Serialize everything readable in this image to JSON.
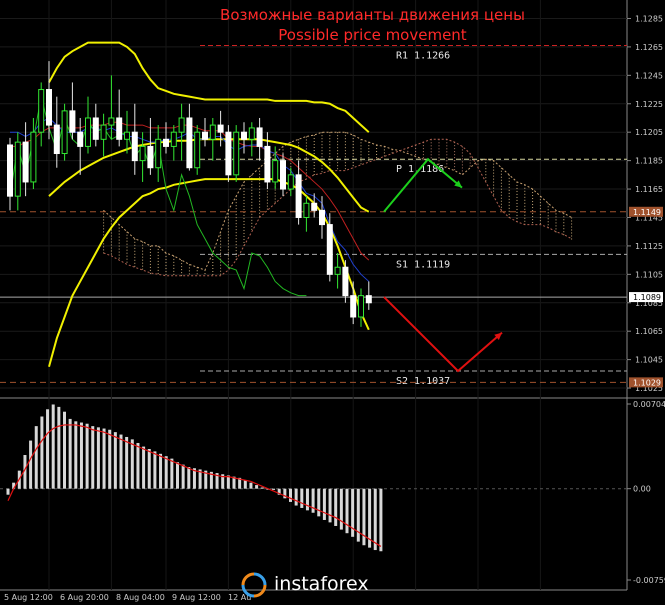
{
  "chart_data": [
    {
      "type": "candlestick",
      "title": "Возможные варианты движения цены",
      "subtitle": "Possible price movement",
      "y_ticks": [
        "1.1285",
        "1.1265",
        "1.1245",
        "1.1225",
        "1.1205",
        "1.1185",
        "1.1165",
        "1.1145",
        "1.1125",
        "1.1105",
        "1.1085",
        "1.1065",
        "1.1045",
        "1.1025"
      ],
      "x_ticks": [
        "5 Aug 12:00",
        "6 Aug 20:00",
        "8 Aug 04:00",
        "9 Aug 12:00",
        "12 Au"
      ],
      "ylim": [
        1.1018,
        1.1298
      ],
      "levels": [
        {
          "name": "R1",
          "label": "R1  1.1266",
          "value": 1.1266,
          "color": "#cc2222"
        },
        {
          "name": "P",
          "label": "P  1.1186",
          "value": 1.1186,
          "color": "#d8d8a0"
        },
        {
          "name": "S1",
          "label": "S1  1.1119",
          "value": 1.1119,
          "color": "#aaaaaa"
        },
        {
          "name": "S2",
          "label": "S2  1.1037",
          "value": 1.1037,
          "color": "#aaaaaa"
        }
      ],
      "price_markers": [
        {
          "label": "1.1149",
          "value": 1.1149,
          "color": "#a0522d"
        },
        {
          "label": "1.1089",
          "value": 1.1089,
          "color": "#ffffff"
        },
        {
          "label": "1.1029",
          "value": 1.1029,
          "color": "#a0522d"
        }
      ],
      "candles": [
        [
          1.1196,
          1.1201,
          1.115,
          1.116
        ],
        [
          1.116,
          1.1205,
          1.115,
          1.1198
        ],
        [
          1.1198,
          1.1212,
          1.116,
          1.117
        ],
        [
          1.117,
          1.1215,
          1.1165,
          1.1205
        ],
        [
          1.1205,
          1.124,
          1.1195,
          1.1235
        ],
        [
          1.1235,
          1.1255,
          1.12,
          1.121
        ],
        [
          1.121,
          1.123,
          1.118,
          1.119
        ],
        [
          1.119,
          1.1225,
          1.1185,
          1.122
        ],
        [
          1.122,
          1.124,
          1.12,
          1.1205
        ],
        [
          1.1205,
          1.1215,
          1.1175,
          1.1195
        ],
        [
          1.1195,
          1.123,
          1.119,
          1.1215
        ],
        [
          1.1215,
          1.1225,
          1.1195,
          1.12
        ],
        [
          1.12,
          1.1218,
          1.1188,
          1.121
        ],
        [
          1.121,
          1.1245,
          1.12,
          1.1215
        ],
        [
          1.1215,
          1.1235,
          1.1195,
          1.12
        ],
        [
          1.12,
          1.122,
          1.119,
          1.1205
        ],
        [
          1.1205,
          1.1225,
          1.1175,
          1.1185
        ],
        [
          1.1185,
          1.1205,
          1.117,
          1.1195
        ],
        [
          1.1195,
          1.1215,
          1.1175,
          1.118
        ],
        [
          1.118,
          1.121,
          1.117,
          1.12
        ],
        [
          1.12,
          1.1212,
          1.119,
          1.1195
        ],
        [
          1.1195,
          1.121,
          1.1185,
          1.1205
        ],
        [
          1.1205,
          1.1225,
          1.1185,
          1.1215
        ],
        [
          1.1215,
          1.1225,
          1.1178,
          1.118
        ],
        [
          1.118,
          1.121,
          1.1175,
          1.1205
        ],
        [
          1.1205,
          1.1215,
          1.1195,
          1.12
        ],
        [
          1.12,
          1.1215,
          1.1185,
          1.121
        ],
        [
          1.121,
          1.122,
          1.1195,
          1.1205
        ],
        [
          1.1205,
          1.121,
          1.117,
          1.1175
        ],
        [
          1.1175,
          1.121,
          1.117,
          1.1205
        ],
        [
          1.1205,
          1.1212,
          1.119,
          1.12
        ],
        [
          1.12,
          1.1212,
          1.1188,
          1.1208
        ],
        [
          1.1208,
          1.1215,
          1.1185,
          1.1195
        ],
        [
          1.1195,
          1.1205,
          1.1165,
          1.117
        ],
        [
          1.117,
          1.1195,
          1.1165,
          1.1185
        ],
        [
          1.1185,
          1.119,
          1.116,
          1.1165
        ],
        [
          1.1165,
          1.118,
          1.116,
          1.1175
        ],
        [
          1.1175,
          1.1185,
          1.114,
          1.1145
        ],
        [
          1.1145,
          1.116,
          1.1135,
          1.1155
        ],
        [
          1.1155,
          1.1162,
          1.1145,
          1.115
        ],
        [
          1.115,
          1.116,
          1.113,
          1.114
        ],
        [
          1.114,
          1.1148,
          1.11,
          1.1105
        ],
        [
          1.1105,
          1.112,
          1.1095,
          1.111
        ],
        [
          1.111,
          1.1115,
          1.1085,
          1.109
        ],
        [
          1.109,
          1.11,
          1.107,
          1.1075
        ],
        [
          1.1075,
          1.1095,
          1.1068,
          1.109
        ],
        [
          1.109,
          1.11,
          1.108,
          1.1085
        ]
      ],
      "ichimoku": {
        "tenkan": [
          1.1205,
          1.1205,
          1.1202,
          1.1205,
          1.1212,
          1.1215,
          1.121,
          1.1205,
          1.1205,
          1.1205,
          1.1208,
          1.1208,
          1.1206,
          1.1208,
          1.1205,
          1.1202,
          1.1202,
          1.12,
          1.1198,
          1.1198,
          1.12,
          1.12,
          1.1202,
          1.1205,
          1.12,
          1.12,
          1.1202,
          1.1202,
          1.1196,
          1.1192,
          1.1195,
          1.1196,
          1.1196,
          1.1192,
          1.119,
          1.1182,
          1.1178,
          1.117,
          1.1162,
          1.116,
          1.1155,
          1.114,
          1.1128,
          1.1122,
          1.1112,
          1.1105,
          1.11
        ],
        "kijun": [
          1.1195,
          1.1195,
          1.1198,
          1.12,
          1.1205,
          1.1208,
          1.1208,
          1.1208,
          1.1208,
          1.1208,
          1.121,
          1.121,
          1.121,
          1.1212,
          1.1212,
          1.121,
          1.121,
          1.121,
          1.1208,
          1.1208,
          1.1208,
          1.1208,
          1.121,
          1.121,
          1.1208,
          1.1206,
          1.1206,
          1.1206,
          1.12,
          1.1198,
          1.1196,
          1.1195,
          1.1195,
          1.1192,
          1.119,
          1.1188,
          1.1185,
          1.118,
          1.1175,
          1.117,
          1.1165,
          1.1158,
          1.115,
          1.114,
          1.113,
          1.112,
          1.1115
        ],
        "span_a": [
          1.115,
          1.1145,
          1.114,
          1.1135,
          1.113,
          1.1128,
          1.1125,
          1.1125,
          1.112,
          1.1118,
          1.1115,
          1.1112,
          1.111,
          1.1108,
          1.112,
          1.1135,
          1.115,
          1.116,
          1.117,
          1.1175,
          1.118,
          1.1185,
          1.119,
          1.1195,
          1.1198,
          1.12,
          1.1202,
          1.1203,
          1.1205,
          1.1205,
          1.1205,
          1.1205,
          1.1203,
          1.12,
          1.1198,
          1.1196,
          1.1195,
          1.1193,
          1.1192,
          1.119,
          1.1188,
          1.1186,
          1.1184,
          1.1182,
          1.118,
          1.1178,
          1.1175,
          1.118,
          1.1185,
          1.1186,
          1.1185,
          1.118,
          1.1175,
          1.117,
          1.1168,
          1.1165,
          1.116,
          1.1155,
          1.115,
          1.1148,
          1.1145
        ],
        "span_b": [
          1.112,
          1.1118,
          1.1115,
          1.1112,
          1.111,
          1.1108,
          1.1106,
          1.1105,
          1.1104,
          1.1104,
          1.1104,
          1.1104,
          1.1104,
          1.1104,
          1.1104,
          1.1104,
          1.1108,
          1.1115,
          1.1125,
          1.1135,
          1.1145,
          1.115,
          1.1155,
          1.116,
          1.1165,
          1.117,
          1.1172,
          1.1175,
          1.1176,
          1.1178,
          1.1178,
          1.1178,
          1.118,
          1.1182,
          1.1184,
          1.1186,
          1.1188,
          1.119,
          1.1192,
          1.1194,
          1.1196,
          1.1198,
          1.12,
          1.12,
          1.12,
          1.1198,
          1.1195,
          1.119,
          1.118,
          1.117,
          1.116,
          1.115,
          1.1145,
          1.1142,
          1.114,
          1.114,
          1.114,
          1.1138,
          1.1135,
          1.1133,
          1.113
        ],
        "chikou": [
          1.116,
          1.1195,
          1.1175,
          1.12,
          1.123,
          1.1208,
          1.1192,
          1.1215,
          1.12,
          1.1195,
          1.1212,
          1.1205,
          1.1208,
          1.12,
          1.1203,
          1.1205,
          1.1188,
          1.1195,
          1.118,
          1.1198,
          1.1165,
          1.115,
          1.1175,
          1.116,
          1.114,
          1.113,
          1.112,
          1.1115,
          1.111,
          1.1108,
          1.1095,
          1.112,
          1.1118,
          1.111,
          1.11,
          1.1095,
          1.1092,
          1.109,
          1.109
        ]
      },
      "bollinger": {
        "upper": [
          1.124,
          1.125,
          1.1258,
          1.1262,
          1.1265,
          1.1268,
          1.1268,
          1.1268,
          1.1268,
          1.1268,
          1.1265,
          1.126,
          1.125,
          1.1242,
          1.1236,
          1.1234,
          1.1232,
          1.1231,
          1.123,
          1.1229,
          1.1228,
          1.1228,
          1.1228,
          1.1228,
          1.1228,
          1.1228,
          1.1228,
          1.1228,
          1.1228,
          1.1227,
          1.1227,
          1.1227,
          1.1227,
          1.1227,
          1.1226,
          1.1226,
          1.1225,
          1.1222,
          1.122,
          1.1215,
          1.121,
          1.1205
        ],
        "middle": [
          1.116,
          1.1165,
          1.117,
          1.1174,
          1.1178,
          1.1181,
          1.1184,
          1.1187,
          1.1189,
          1.1191,
          1.1193,
          1.1195,
          1.1196,
          1.1197,
          1.1198,
          1.1198,
          1.1199,
          1.1199,
          1.1199,
          1.12,
          1.12,
          1.12,
          1.12,
          1.12,
          1.12,
          1.12,
          1.12,
          1.12,
          1.1199,
          1.1198,
          1.1197,
          1.1196,
          1.1194,
          1.1191,
          1.1188,
          1.1184,
          1.1179,
          1.1173,
          1.1166,
          1.1159,
          1.1152,
          1.1149
        ],
        "lower": [
          1.104,
          1.106,
          1.1075,
          1.109,
          1.11,
          1.111,
          1.112,
          1.113,
          1.1138,
          1.1145,
          1.115,
          1.1155,
          1.116,
          1.1162,
          1.1165,
          1.1166,
          1.1168,
          1.1169,
          1.117,
          1.1171,
          1.1172,
          1.1172,
          1.1172,
          1.1172,
          1.1172,
          1.1172,
          1.1172,
          1.1172,
          1.1172,
          1.1172,
          1.117,
          1.1168,
          1.1165,
          1.116,
          1.1155,
          1.1148,
          1.1138,
          1.1125,
          1.111,
          1.1095,
          1.1078,
          1.1066
        ]
      },
      "forecast_up": [
        [
          1.1149,
          1.1186,
          1.1166
        ]
      ],
      "forecast_down": [
        [
          1.1089,
          1.1037,
          1.1064
        ]
      ]
    },
    {
      "type": "bar",
      "name": "MACD",
      "y_ticks": [
        "0.00704",
        "0.00",
        "-0.00759"
      ],
      "ylim": [
        -0.00759,
        0.00704
      ],
      "values": [
        -0.0005,
        0.0005,
        0.0015,
        0.0028,
        0.004,
        0.0052,
        0.006,
        0.0066,
        0.007,
        0.0068,
        0.0064,
        0.0058,
        0.0056,
        0.0055,
        0.0054,
        0.0052,
        0.0051,
        0.005,
        0.0049,
        0.0047,
        0.0045,
        0.0043,
        0.0041,
        0.0038,
        0.0035,
        0.0033,
        0.0031,
        0.0029,
        0.0027,
        0.0025,
        0.0022,
        0.002,
        0.0018,
        0.0017,
        0.0016,
        0.0015,
        0.0014,
        0.0013,
        0.0012,
        0.0011,
        0.001,
        0.0009,
        0.0007,
        0.0005,
        0.0003,
        0.0001,
        0.0,
        -0.0001,
        -0.0005,
        -0.0008,
        -0.0011,
        -0.0014,
        -0.0016,
        -0.0018,
        -0.002,
        -0.0023,
        -0.0026,
        -0.0028,
        -0.0031,
        -0.0034,
        -0.0037,
        -0.004,
        -0.0044,
        -0.0047,
        -0.0049,
        -0.0051,
        -0.0052
      ],
      "signal": [
        -0.001,
        0.0,
        0.0008,
        0.0016,
        0.0025,
        0.0033,
        0.004,
        0.0046,
        0.005,
        0.0052,
        0.0053,
        0.0053,
        0.0053,
        0.0052,
        0.0051,
        0.0049,
        0.0048,
        0.0047,
        0.0045,
        0.0043,
        0.0041,
        0.0039,
        0.0037,
        0.0035,
        0.0033,
        0.0031,
        0.0029,
        0.0027,
        0.0025,
        0.0023,
        0.0021,
        0.0019,
        0.0017,
        0.0015,
        0.0014,
        0.0013,
        0.0012,
        0.0011,
        0.001,
        0.001,
        0.0009,
        0.0008,
        0.0007,
        0.0006,
        0.0004,
        0.0002,
        0.0,
        -0.0002,
        -0.0004,
        -0.0006,
        -0.0008,
        -0.001,
        -0.0012,
        -0.0014,
        -0.0016,
        -0.0018,
        -0.002,
        -0.0022,
        -0.0024,
        -0.0027,
        -0.003,
        -0.0033,
        -0.0036,
        -0.0039,
        -0.0042,
        -0.0045,
        -0.0048
      ]
    }
  ],
  "title": "Возможные варианты движения цены",
  "subtitle": "Possible price movement",
  "brand": "instaforex"
}
